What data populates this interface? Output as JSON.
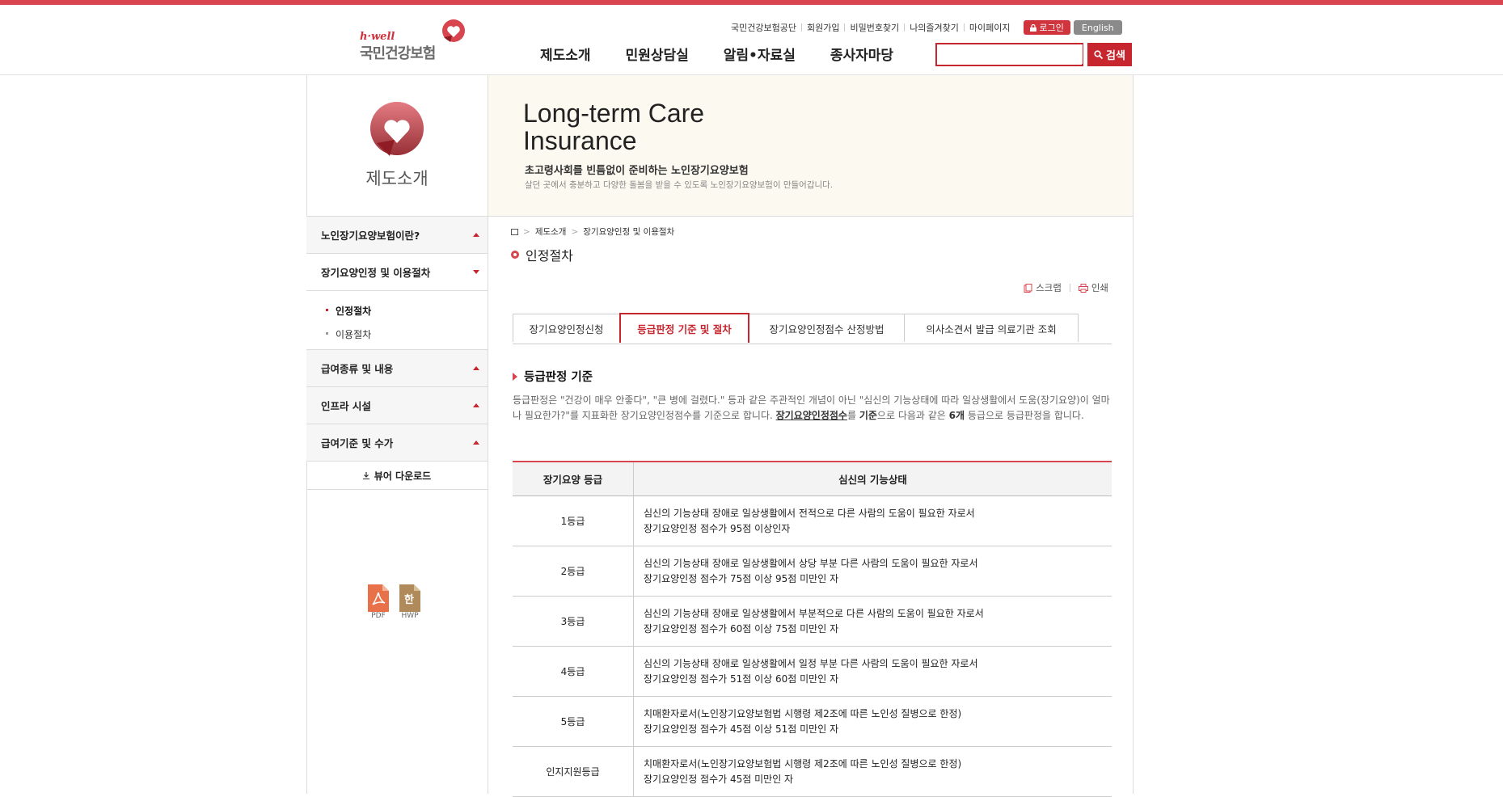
{
  "header": {
    "logo": {
      "sub": "h·well",
      "name": "국민건강보험"
    },
    "util_links": [
      "국민건강보험공단",
      "회원가입",
      "비밀번호찾기",
      "나의즐겨찾기",
      "마이페이지"
    ],
    "login_label": "로그인",
    "english_label": "English",
    "gnb": [
      "제도소개",
      "민원상담실",
      "알림•자료실",
      "종사자마당"
    ],
    "search": {
      "value": "",
      "button_label": "검색"
    }
  },
  "lnb": {
    "title": "제도소개",
    "items": [
      {
        "label": "노인장기요양보험이란?"
      },
      {
        "label": "장기요양인정 및 이용절차"
      },
      {
        "label": "급여종류 및 내용"
      },
      {
        "label": "인프라 시설"
      },
      {
        "label": "급여기준 및 수가"
      }
    ],
    "sub_items": [
      {
        "label": "인정절차"
      },
      {
        "label": "이용절차"
      }
    ],
    "viewer_label": "뷰어 다운로드",
    "downloads": [
      {
        "label": "PDF",
        "icon": "pdf-icon",
        "color": "#e8714a"
      },
      {
        "label": "HWP",
        "icon": "hwp-icon",
        "color": "#b08a5a",
        "glyph": "한"
      }
    ]
  },
  "banner": {
    "title_line1": "Long-term Care",
    "title_line2": "Insurance",
    "subtitle": "초고령사회를 빈틈없이 준비하는 노인장기요양보험",
    "desc": "살던 곳에서 충분하고 다양한 돌봄을 받을 수 있도록 노인장기요양보험이 만들어갑니다."
  },
  "breadcrumb": [
    "제도소개",
    "장기요양인정 및 이용절차"
  ],
  "page_title": "인정절차",
  "tools": {
    "scrap": "스크랩",
    "print": "인쇄"
  },
  "tabs": [
    {
      "label": "장기요양인정신청"
    },
    {
      "label": "등급판정 기준 및 절차"
    },
    {
      "label": "장기요양인정점수 산정방법"
    },
    {
      "label": "의사소견서 발급 의료기관 조회"
    }
  ],
  "section": {
    "heading": "등급판정 기준",
    "desc_part1": "등급판정은 \"건강이 매우 안좋다\", \"큰 병에 걸렸다.\" 등과 같은 주관적인 개념이 아닌 \"심신의 기능상태에 따라 일상생활에서 도움(장기요양)이 얼마나 필요한가?\"를 지표화한 장기요양인정점수를 기준으로 합니다. ",
    "desc_link": "장기요양인정점수",
    "desc_part2": "를 ",
    "desc_bold1": "기준",
    "desc_part3": "으로 다음과 같은 ",
    "desc_bold2": "6개",
    "desc_part4": " 등급으로 등급판정을 합니다."
  },
  "table": {
    "headers": [
      "장기요양 등급",
      "심신의 기능상태"
    ],
    "rows": [
      {
        "grade": "1등급",
        "line1": "심신의 기능상태 장애로 일상생활에서 전적으로 다른 사람의 도움이 필요한 자로서",
        "line2": "장기요양인정 점수가 95점 이상인자"
      },
      {
        "grade": "2등급",
        "line1": "심신의 기능상태 장애로 일상생활에서 상당 부분 다른 사람의 도움이 필요한 자로서",
        "line2": "장기요양인정 점수가 75점 이상 95점 미만인 자"
      },
      {
        "grade": "3등급",
        "line1": "심신의 기능상태 장애로 일상생활에서 부분적으로 다른 사람의 도움이 필요한 자로서",
        "line2": "장기요양인정 점수가 60점 이상 75점 미만인 자"
      },
      {
        "grade": "4등급",
        "line1": "심신의 기능상태 장애로 일상생활에서 일정 부분 다른 사람의 도움이 필요한 자로서",
        "line2": "장기요양인정 점수가 51점 이상 60점 미만인 자"
      },
      {
        "grade": "5등급",
        "line1": "치매환자로서(노인장기요양보험법 시행령 제2조에 따른 노인성 질병으로 한정)",
        "line2": "장기요양인정 점수가 45점 이상 51점 미만인 자"
      },
      {
        "grade": "인지지원등급",
        "line1": "치매환자로서(노인장기요양보험법 시행령 제2조에 따른 노인성 질병으로 한정)",
        "line2": "장기요양인정 점수가 45점 미만인 자"
      }
    ]
  },
  "colors": {
    "brand": "#d8454e",
    "accent": "#c8262f",
    "banner_bg": "#fcfaf0"
  }
}
